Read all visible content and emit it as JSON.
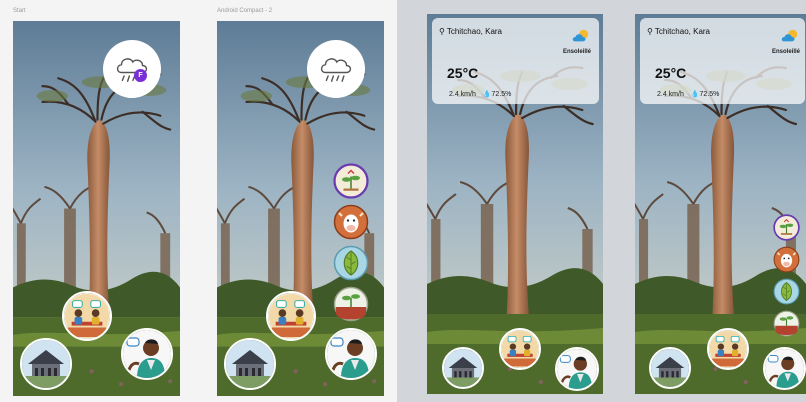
{
  "frames": {
    "start_label": "Start",
    "compact_label": "Android Compact - 2"
  },
  "avatar_badge": "F",
  "weather": {
    "city": "Tchitchao, Kara",
    "temperature": "25°C",
    "wind": "2.4 km/h",
    "humidity": "72.5%",
    "condition": "Ensoleillé"
  },
  "icons": {
    "weather_button": "rain-cloud-icon",
    "meeting_button": "meeting-people-icon",
    "village_button": "village-hut-icon",
    "assistant_button": "farmer-assistant-icon",
    "side_1": "plant-health-icon",
    "side_2": "livestock-cow-icon",
    "side_3": "leaf-icon",
    "side_4": "seedling-soil-icon"
  },
  "colors": {
    "accent": "#7b2fd6",
    "sky": "#8fa9bc",
    "ground": "#4f6b2c"
  }
}
